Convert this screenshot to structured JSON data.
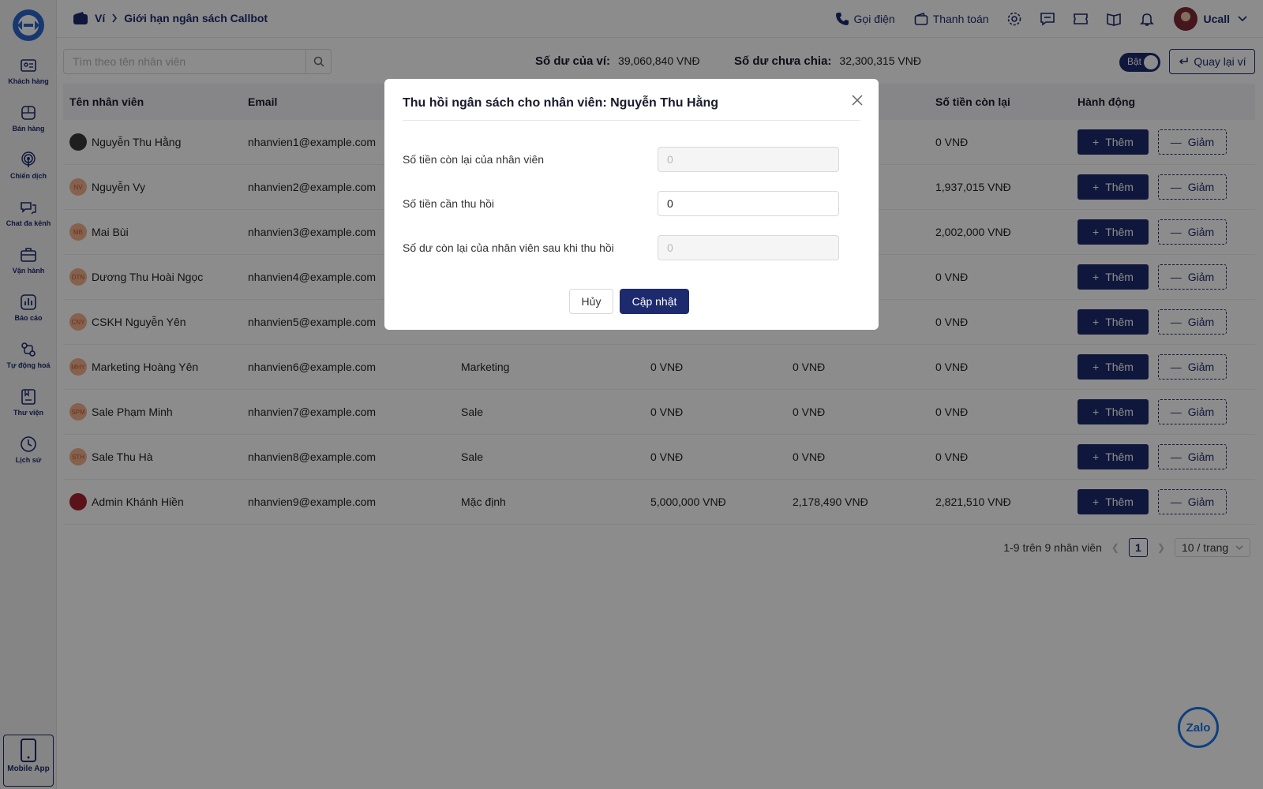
{
  "sidebar": {
    "items": [
      {
        "label": "Khách hàng",
        "icon": "contact-card-icon"
      },
      {
        "label": "Bán hàng",
        "icon": "box-icon"
      },
      {
        "label": "Chiến dịch",
        "icon": "broadcast-icon"
      },
      {
        "label": "Chat đa kênh",
        "icon": "chat-icon"
      },
      {
        "label": "Vận hành",
        "icon": "briefcase-icon"
      },
      {
        "label": "Báo cáo",
        "icon": "bar-chart-icon"
      },
      {
        "label": "Tự động hoá",
        "icon": "automation-icon"
      },
      {
        "label": "Thư viện",
        "icon": "library-icon"
      },
      {
        "label": "Lịch sử",
        "icon": "clock-icon"
      }
    ],
    "mobile_app": "Mobile App"
  },
  "header": {
    "breadcrumb_root": "Ví",
    "breadcrumb_current": "Giới hạn ngân sách Callbot",
    "call_label": "Gọi điện",
    "payment_label": "Thanh toán",
    "user_name": "Ucall"
  },
  "toolbar": {
    "search_placeholder": "Tìm theo tên nhân viên",
    "wallet_balance_label": "Số dư của ví:",
    "wallet_balance_value": "39,060,840 VNĐ",
    "unallocated_label": "Số dư chưa chia:",
    "unallocated_value": "32,300,315 VNĐ",
    "toggle_label": "Bật",
    "back_label": "Quay lại ví"
  },
  "table": {
    "headers": [
      "Tên nhân viên",
      "Email",
      "",
      "",
      "",
      "Số tiền còn lại",
      "Hành động"
    ],
    "add_label": "Thêm",
    "sub_label": "Giảm",
    "rows": [
      {
        "avatar": "",
        "name": "Nguyễn Thu Hằng",
        "email": "nhanvien1@example.com",
        "group": "",
        "budget": "",
        "used": "",
        "remaining": "0 VNĐ"
      },
      {
        "avatar": "NV",
        "name": "Nguyễn Vy",
        "email": "nhanvien2@example.com",
        "group": "",
        "budget": "",
        "used": "",
        "remaining": "1,937,015 VNĐ"
      },
      {
        "avatar": "MB",
        "name": "Mai Bùi",
        "email": "nhanvien3@example.com",
        "group": "",
        "budget": "",
        "used": "",
        "remaining": "2,002,000 VNĐ"
      },
      {
        "avatar": "DTN",
        "name": "Dương Thu Hoài Ngọc",
        "email": "nhanvien4@example.com",
        "group": "",
        "budget": "",
        "used": "",
        "remaining": "0 VNĐ"
      },
      {
        "avatar": "CNY",
        "name": "CSKH Nguyễn Yên",
        "email": "nhanvien5@example.com",
        "group": "",
        "budget": "",
        "used": "",
        "remaining": "0 VNĐ"
      },
      {
        "avatar": "MHY",
        "name": "Marketing Hoàng Yên",
        "email": "nhanvien6@example.com",
        "group": "Marketing",
        "budget": "0 VNĐ",
        "used": "0 VNĐ",
        "remaining": "0 VNĐ"
      },
      {
        "avatar": "SPM",
        "name": "Sale Phạm Minh",
        "email": "nhanvien7@example.com",
        "group": "Sale",
        "budget": "0 VNĐ",
        "used": "0 VNĐ",
        "remaining": "0 VNĐ"
      },
      {
        "avatar": "STH",
        "name": "Sale Thu Hà",
        "email": "nhanvien8@example.com",
        "group": "Sale",
        "budget": "0 VNĐ",
        "used": "0 VNĐ",
        "remaining": "0 VNĐ"
      },
      {
        "avatar": "",
        "name": "Admin Khánh Hiền",
        "email": "nhanvien9@example.com",
        "group": "Mặc định",
        "budget": "5,000,000 VNĐ",
        "used": "2,178,490 VNĐ",
        "remaining": "2,821,510 VNĐ"
      }
    ]
  },
  "pagination": {
    "summary": "1-9 trên 9 nhân viên",
    "current_page": "1",
    "page_size": "10 / trang"
  },
  "modal": {
    "title": "Thu hồi ngân sách cho nhân viên: Nguyễn Thu Hằng",
    "field1_label": "Số tiền còn lại của nhân viên",
    "field1_value": "0",
    "field2_label": "Số tiền cần thu hồi",
    "field2_value": "0",
    "field3_label": "Số dư còn lại của nhân viên sau khi thu hồi",
    "field3_value": "0",
    "cancel_label": "Hủy",
    "update_label": "Cập nhật"
  },
  "zalo_label": "Zalo",
  "colors": {
    "primary": "#1e2a6e",
    "overlay": "rgba(0,0,0,0.45)"
  }
}
